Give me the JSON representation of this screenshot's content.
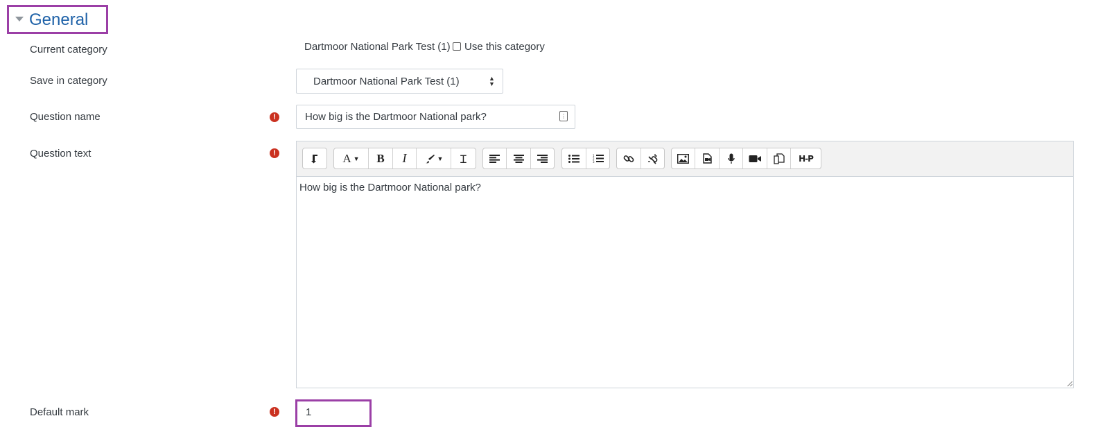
{
  "section": {
    "title": "General",
    "caret_icon": "caret-down-icon"
  },
  "fields": {
    "current_category": {
      "label": "Current category",
      "value": "Dartmoor National Park Test (1)",
      "checkbox_label": "Use this category",
      "checked": false
    },
    "save_in_category": {
      "label": "Save in category",
      "selected": "Dartmoor National Park Test (1)"
    },
    "question_name": {
      "label": "Question name",
      "value": "How big is the Dartmoor National park?"
    },
    "question_text": {
      "label": "Question text",
      "value": "How big is the Dartmoor National park?"
    },
    "default_mark": {
      "label": "Default mark",
      "value": "1"
    }
  },
  "required_icon": "exclamation-circle-icon",
  "toolbar": {
    "groups": [
      [
        "show-more-icon"
      ],
      [
        "font-icon",
        "bold-icon",
        "italic-icon",
        "font-color-icon",
        "clear-formatting-icon"
      ],
      [
        "align-left-icon",
        "align-center-icon",
        "align-right-icon"
      ],
      [
        "unordered-list-icon",
        "ordered-list-icon"
      ],
      [
        "link-icon",
        "unlink-icon"
      ],
      [
        "image-icon",
        "media-icon",
        "record-audio-icon",
        "record-video-icon",
        "manage-files-icon",
        "h5p-icon"
      ]
    ],
    "h5p_label": "H-P"
  },
  "colors": {
    "accent_outline": "#9b3fa6",
    "title_blue": "#1f62a8",
    "required_red": "#ca3120"
  }
}
